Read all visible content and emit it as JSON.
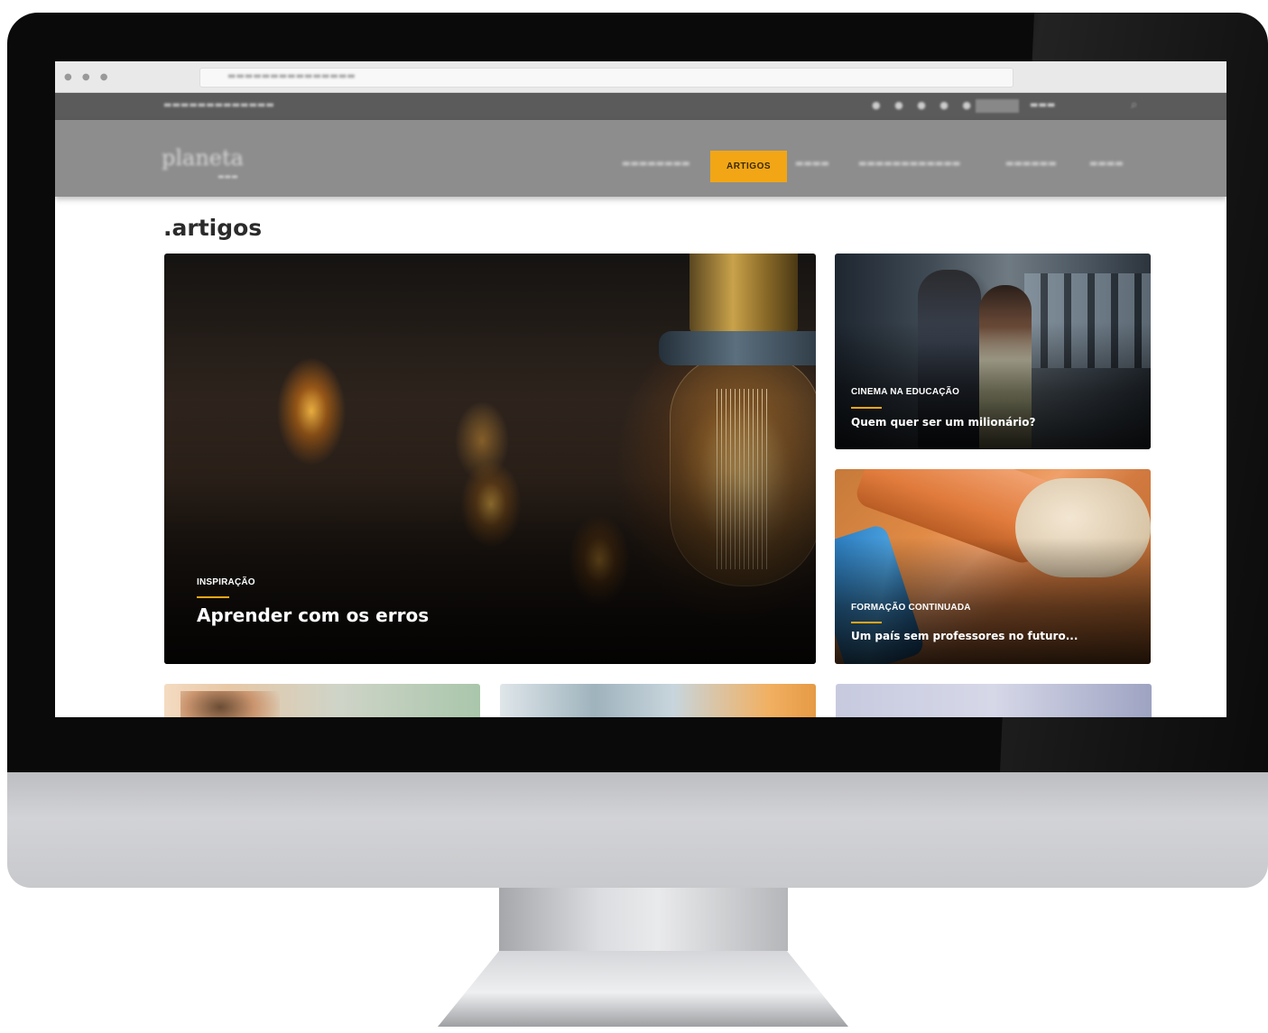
{
  "nav": {
    "active_label": "ARTIGOS"
  },
  "page": {
    "title": ".artigos"
  },
  "featured": {
    "category": "INSPIRAÇÃO",
    "title": "Aprender com os erros"
  },
  "side_cards": [
    {
      "category": "CINEMA NA EDUCAÇÃO",
      "title": "Quem quer ser um milionário?"
    },
    {
      "category": "FORMAÇÃO CONTINUADA",
      "title": "Um país sem professores no futuro..."
    }
  ],
  "colors": {
    "accent": "#f2a616",
    "nav_bg": "#8d8d8d",
    "top_strip_bg": "#5b5b5b",
    "title_text": "#2b2b2b"
  }
}
